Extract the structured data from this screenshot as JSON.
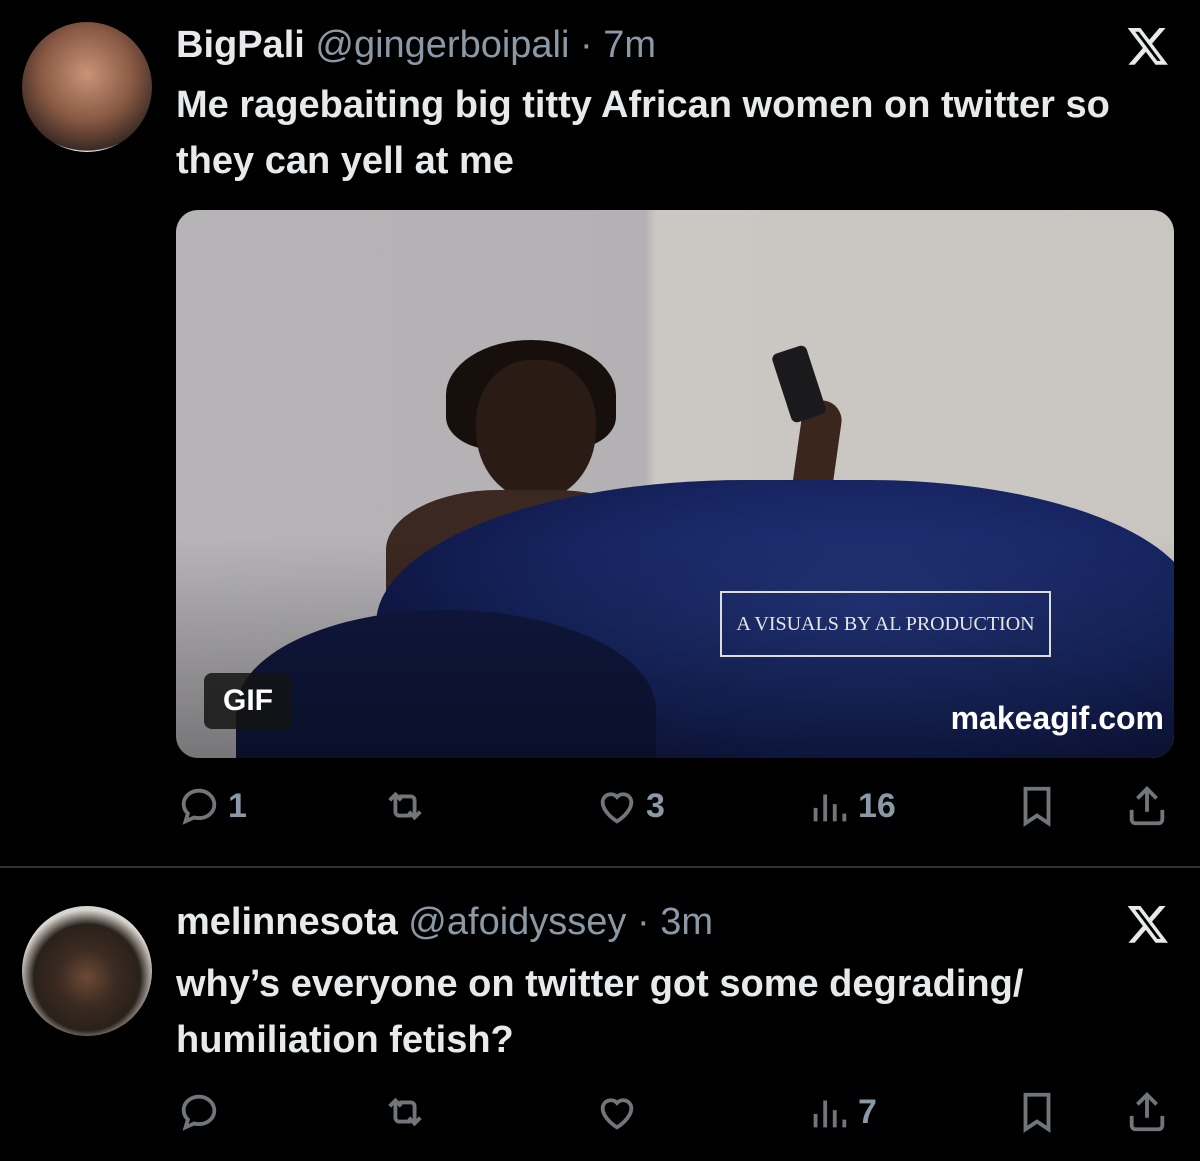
{
  "tweets": [
    {
      "name": "BigPali",
      "handle": "@gingerboipali",
      "time": "7m",
      "separator": "·",
      "text": "Me ragebaiting big titty African women on twitter so they can yell at me",
      "media": {
        "badge": "GIF",
        "watermark": "A VISUALS BY AL PRODUCTION",
        "site": "makeagif.com"
      },
      "stats": {
        "replies": "1",
        "retweets": "",
        "likes": "3",
        "views": "16"
      }
    },
    {
      "name": "melinnesota",
      "handle": "@afoidyssey",
      "time": "3m",
      "separator": "·",
      "text": "why’s everyone on twitter got some degrading/ humiliation fetish?",
      "stats": {
        "replies": "",
        "retweets": "",
        "likes": "",
        "views": "7"
      }
    }
  ],
  "icons": [
    "x-logo-icon",
    "reply-icon",
    "retweet-icon",
    "like-icon",
    "views-icon",
    "bookmark-icon",
    "share-icon"
  ],
  "colors": {
    "background": "#000000",
    "text": "#e7e9ea",
    "muted": "#71767b",
    "divider": "#2f3336"
  }
}
